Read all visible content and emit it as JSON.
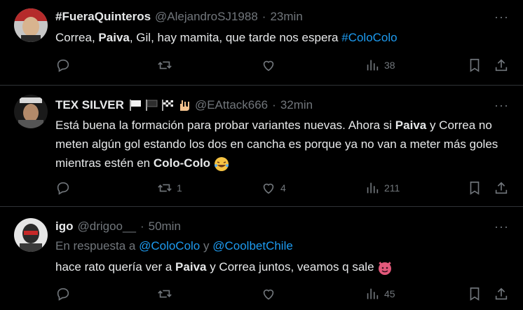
{
  "tweets": [
    {
      "name": "#FueraQuinteros",
      "handle": "@AlejandroSJ1988",
      "dot": "·",
      "time": "23min",
      "text_parts": [
        "Correa, ",
        "Paiva",
        ", Gil, hay mamita, que tarde nos espera ",
        "#ColoColo"
      ],
      "reply_count": "",
      "retweet_count": "",
      "like_count": "",
      "view_count": "38"
    },
    {
      "name": "TEX SILVER",
      "handle": "@EAttack666",
      "dot": "·",
      "time": "32min",
      "text_parts": [
        "Está buena la formación para probar variantes nuevas. Ahora si ",
        "Paiva",
        " y Correa no meten algún gol estando los dos en cancha es porque ya no van a meter más goles mientras estén en ",
        "Colo-Colo"
      ],
      "reply_count": "",
      "retweet_count": "1",
      "like_count": "4",
      "view_count": "211"
    },
    {
      "name": "igo",
      "handle": "@drigoo__",
      "dot": "·",
      "time": "50min",
      "reply_prefix": "En respuesta a ",
      "reply_user1": "@ColoColo",
      "reply_join": " y ",
      "reply_user2": "@CoolbetChile",
      "text_parts": [
        "hace rato quería ver a ",
        "Paiva",
        " y Correa juntos, veamos q sale"
      ],
      "reply_count": "",
      "retweet_count": "",
      "like_count": "",
      "view_count": "45"
    }
  ],
  "more_label": "···",
  "colors": {
    "background": "#000000",
    "text": "#e7e9ea",
    "muted": "#71767b",
    "link": "#1d9bf0",
    "border": "#2f3336"
  },
  "icons": [
    "reply-icon",
    "retweet-icon",
    "like-icon",
    "views-icon",
    "bookmark-icon",
    "share-icon",
    "more-icon"
  ]
}
